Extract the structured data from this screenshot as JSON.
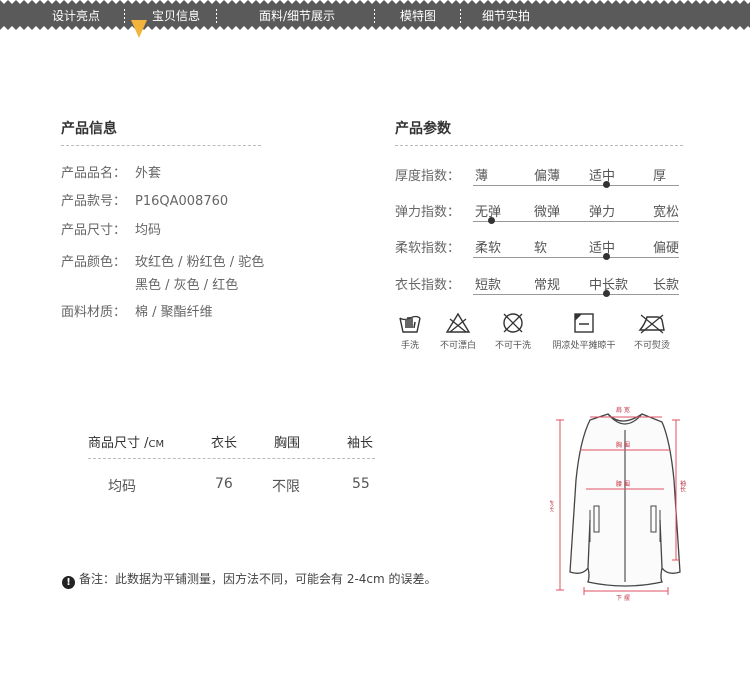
{
  "nav": {
    "tabs": [
      {
        "label": "设计亮点"
      },
      {
        "label": "宝贝信息"
      },
      {
        "label": "面料/细节展示"
      },
      {
        "label": "模特图"
      },
      {
        "label": "细节实拍"
      }
    ],
    "active_index": 1,
    "active_marker_color": "#f2b43a"
  },
  "product_info": {
    "title": "产品信息",
    "rows": [
      {
        "key": "产品品名：",
        "value": "外套"
      },
      {
        "key": "产品款号：",
        "value": "P16QA008760"
      },
      {
        "key": "产品尺寸：",
        "value": "均码"
      },
      {
        "key": "产品颜色：",
        "value": "玫红色 / 粉红色 / 驼色",
        "value2": "黑色 / 灰色 / 红色"
      },
      {
        "key": "面料材质：",
        "value": "棉 / 聚酯纤维"
      }
    ]
  },
  "product_params": {
    "title": "产品参数",
    "rows": [
      {
        "label": "厚度指数：",
        "options": [
          "薄",
          "偏薄",
          "适中",
          "厚"
        ],
        "selected_index": 2
      },
      {
        "label": "弹力指数：",
        "options": [
          "无弹",
          "微弹",
          "弹力",
          "宽松"
        ],
        "selected_index": 0
      },
      {
        "label": "柔软指数：",
        "options": [
          "柔软",
          "软",
          "适中",
          "偏硬"
        ],
        "selected_index": 2
      },
      {
        "label": "衣长指数：",
        "options": [
          "短款",
          "常规",
          "中长款",
          "长款"
        ],
        "selected_index": 2
      }
    ],
    "care": [
      {
        "icon": "hand-wash-icon",
        "label": "手洗"
      },
      {
        "icon": "no-bleach-icon",
        "label": "不可漂白"
      },
      {
        "icon": "no-tumble-dry-icon",
        "label": "不可干洗"
      },
      {
        "icon": "shade-flat-dry-icon",
        "label": "阴凉处平摊晾干"
      },
      {
        "icon": "no-iron-icon",
        "label": "不可熨烫"
      }
    ]
  },
  "size_table": {
    "headers": [
      "商品尺寸 /",
      "CM",
      "衣长",
      "胸围",
      "袖长"
    ],
    "rows": [
      [
        "均码",
        "76",
        "不限",
        "55"
      ]
    ]
  },
  "diagram": {
    "labels": {
      "shoulder": "肩 宽",
      "chest": "胸 围",
      "waist": "腰 围",
      "hem": "下 摆",
      "length": "衣长",
      "sleeve": "袖长"
    },
    "measure_color": "#e05060"
  },
  "note": {
    "icon": "exclamation-icon",
    "text": "备注：此数据为平铺测量，因方法不同，可能会有 2-4cm 的误差。"
  }
}
